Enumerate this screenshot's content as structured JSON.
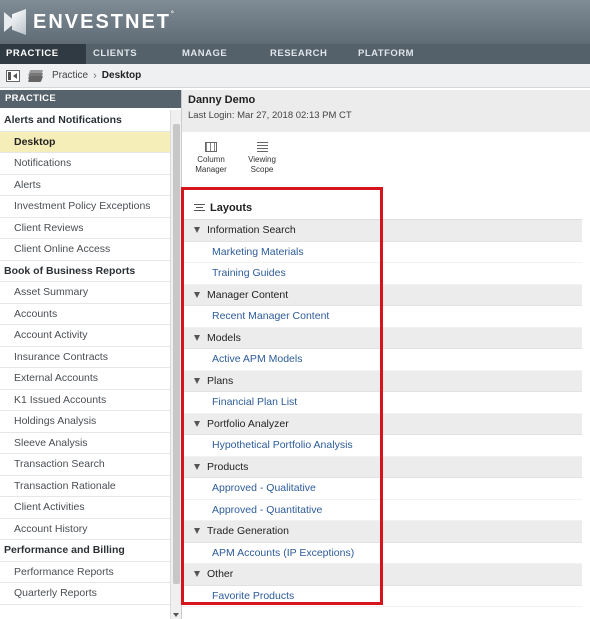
{
  "brand": {
    "name": "ENVESTNET",
    "tm": "°"
  },
  "nav": [
    {
      "label": "PRACTICE",
      "active": true
    },
    {
      "label": "CLIENTS",
      "active": false
    },
    {
      "label": "MANAGE",
      "active": false
    },
    {
      "label": "RESEARCH",
      "active": false
    },
    {
      "label": "PLATFORM",
      "active": false
    }
  ],
  "breadcrumb": {
    "parent": "Practice",
    "sep": "›",
    "current": "Desktop"
  },
  "sidebar": {
    "title": "PRACTICE",
    "items": [
      {
        "label": "Alerts and Notifications",
        "type": "section"
      },
      {
        "label": "Desktop",
        "type": "item",
        "selected": true
      },
      {
        "label": "Notifications",
        "type": "item"
      },
      {
        "label": "Alerts",
        "type": "item"
      },
      {
        "label": "Investment Policy Exceptions",
        "type": "item"
      },
      {
        "label": "Client Reviews",
        "type": "item"
      },
      {
        "label": "Client Online Access",
        "type": "item"
      },
      {
        "label": "Book of Business Reports",
        "type": "section"
      },
      {
        "label": "Asset Summary",
        "type": "item"
      },
      {
        "label": "Accounts",
        "type": "item"
      },
      {
        "label": "Account Activity",
        "type": "item"
      },
      {
        "label": "Insurance Contracts",
        "type": "item"
      },
      {
        "label": "External Accounts",
        "type": "item"
      },
      {
        "label": "K1 Issued Accounts",
        "type": "item"
      },
      {
        "label": "Holdings Analysis",
        "type": "item"
      },
      {
        "label": "Sleeve Analysis",
        "type": "item"
      },
      {
        "label": "Transaction Search",
        "type": "item"
      },
      {
        "label": "Transaction Rationale",
        "type": "item"
      },
      {
        "label": "Client Activities",
        "type": "item"
      },
      {
        "label": "Account History",
        "type": "item"
      },
      {
        "label": "Performance and Billing",
        "type": "section"
      },
      {
        "label": "Performance Reports",
        "type": "item"
      },
      {
        "label": "Quarterly Reports",
        "type": "item"
      }
    ]
  },
  "user": {
    "name": "Danny Demo",
    "last_login": "Last Login: Mar 27, 2018 02:13 PM CT"
  },
  "tools": [
    {
      "line1": "Column",
      "line2": "Manager",
      "icon": "column-manager-icon"
    },
    {
      "line1": "Viewing",
      "line2": "Scope",
      "icon": "viewing-scope-icon"
    }
  ],
  "layouts": {
    "title": "Layouts",
    "groups": [
      {
        "label": "Information Search",
        "links": [
          "Marketing Materials",
          "Training Guides"
        ]
      },
      {
        "label": "Manager Content",
        "links": [
          "Recent Manager Content"
        ]
      },
      {
        "label": "Models",
        "links": [
          "Active APM Models"
        ]
      },
      {
        "label": "Plans",
        "links": [
          "Financial Plan List"
        ]
      },
      {
        "label": "Portfolio Analyzer",
        "links": [
          "Hypothetical Portfolio Analysis"
        ]
      },
      {
        "label": "Products",
        "links": [
          "Approved - Qualitative",
          "Approved - Quantitative"
        ]
      },
      {
        "label": "Trade Generation",
        "links": [
          "APM Accounts (IP Exceptions)"
        ]
      },
      {
        "label": "Other",
        "links": [
          "Favorite Products"
        ]
      }
    ]
  },
  "colors": {
    "highlight_box": "#d5141c",
    "selected_row": "#f6eeb8",
    "link": "#2d5c9a",
    "nav_bg": "#54606a"
  }
}
